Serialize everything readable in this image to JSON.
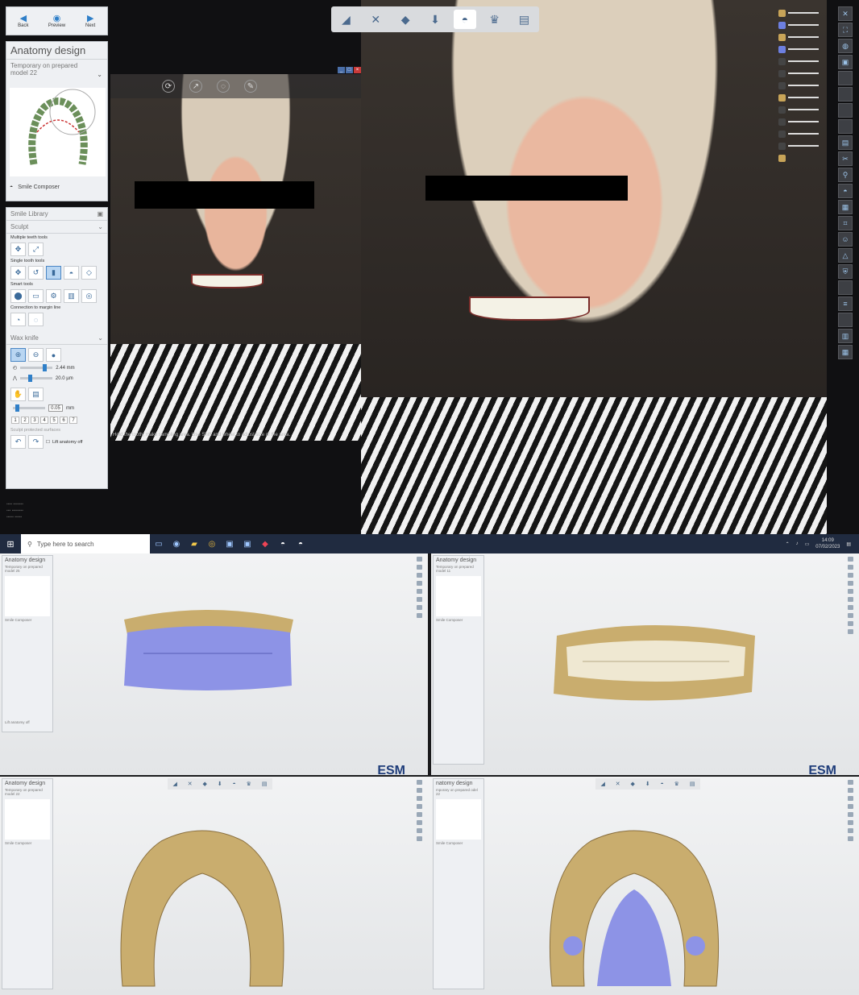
{
  "nav": {
    "back_label": "Back",
    "preview_label": "Preview",
    "next_label": "Next"
  },
  "design_panel": {
    "title": "Anatomy design",
    "subtitle": "Temporary on prepared model 22",
    "smile_composer_label": "Smile Composer"
  },
  "tools_panel": {
    "library_label": "Smile Library",
    "sculpt_label": "Sculpt",
    "multiple_tools_label": "Multiple teeth tools",
    "single_tools_label": "Single tooth tools",
    "smart_tools_label": "Smart tools",
    "connection_label": "Connection to margin line",
    "wax_knife_label": "Wax knife",
    "slider1_value": "2.44 mm",
    "slider2_value": "20.0 µm",
    "thickness_value": "0.05",
    "thickness_unit": "mm",
    "numbers": [
      "1",
      "2",
      "3",
      "4",
      "5",
      "6",
      "7"
    ],
    "protected_label": "Sculpt protected surfaces",
    "lift_label": "Lift anatomy off"
  },
  "small_view": {
    "hint": "Hold the tooth, make sampling area. Use Shift and wheel to adjust size of the area."
  },
  "taskbar": {
    "search_placeholder": "Type here to search",
    "time": "14:09",
    "date": "07/02/2023"
  },
  "quadrants": {
    "q1_title": "Anatomy design",
    "q1_sub": "Temporary on prepared model 25",
    "q2_title": "Anatomy design",
    "q2_sub": "Temporary on prepared model 11",
    "q3_title": "Anatomy design",
    "q3_sub": "Temporary on prepared model 22",
    "q4_title": "natomy design",
    "q4_sub": "mporary on prepared odel 22",
    "logo_text": "ESM",
    "smile_composer_label": "Smile Composer",
    "lift_label": "Lift anatomy off"
  },
  "colors": {
    "accent": "#2f7fc8",
    "wax": "#8d93e6",
    "gingiva": "#c9ad6e",
    "tooth": "#efe8d2"
  }
}
